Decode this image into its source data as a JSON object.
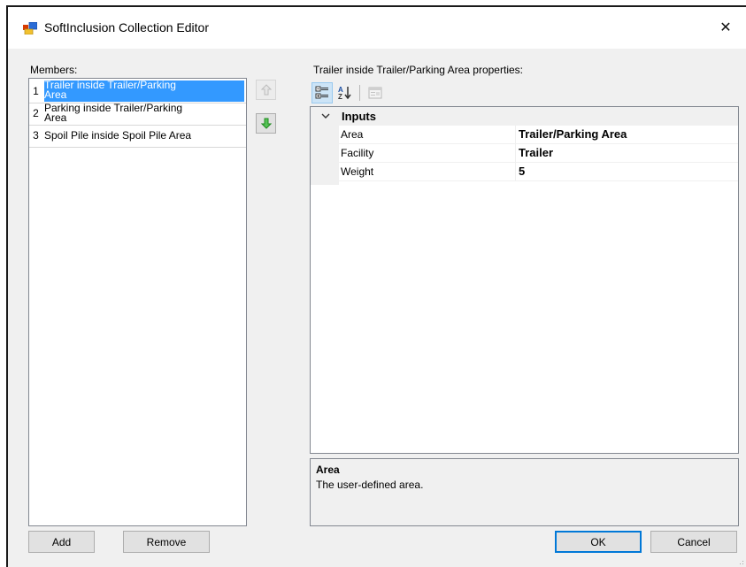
{
  "window": {
    "title": "SoftInclusion Collection Editor",
    "close_glyph": "✕"
  },
  "members": {
    "label": "Members:",
    "items": [
      {
        "index": "1",
        "line1": "Trailer inside Trailer/Parking",
        "line2": "Area",
        "selected": true
      },
      {
        "index": "2",
        "line1": "Parking inside Trailer/Parking",
        "line2": "Area",
        "selected": false
      },
      {
        "index": "3",
        "line1": "Spoil Pile inside Spoil Pile Area",
        "line2": "",
        "selected": false
      }
    ],
    "add_label": "Add",
    "remove_label": "Remove"
  },
  "properties": {
    "header": "Trailer inside Trailer/Parking Area properties:",
    "toolbar": {
      "categorized_icon": "categorized-icon",
      "alphabetical_icon": "alphabetical-icon",
      "property_pages_icon": "property-pages-icon"
    },
    "category": {
      "label": "Inputs",
      "expander": "⌄"
    },
    "rows": [
      {
        "name": "Area",
        "value": "Trailer/Parking Area"
      },
      {
        "name": "Facility",
        "value": "Trailer"
      },
      {
        "name": "Weight",
        "value": "5"
      }
    ],
    "help": {
      "title": "Area",
      "description": "The user-defined area."
    }
  },
  "dialog": {
    "ok_label": "OK",
    "cancel_label": "Cancel"
  },
  "colors": {
    "selection": "#3399ff",
    "default_button_border": "#0078d7",
    "up_arrow": "#c0c0c0",
    "down_arrow": "#2aa52a"
  }
}
